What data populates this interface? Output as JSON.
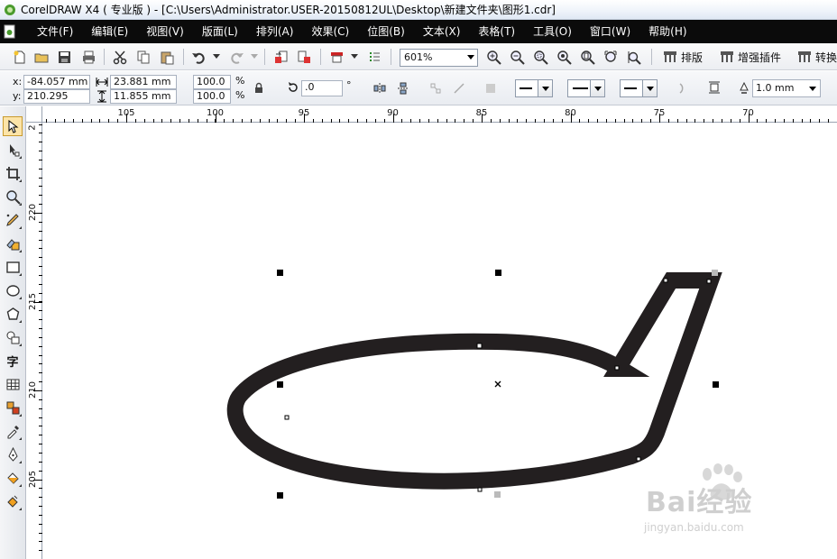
{
  "window": {
    "title": "CorelDRAW X4 ( 专业版 ) - [C:\\Users\\Administrator.USER-20150812UL\\Desktop\\新建文件夹\\图形1.cdr]"
  },
  "menu": {
    "items": [
      {
        "label": "文件(F)"
      },
      {
        "label": "编辑(E)"
      },
      {
        "label": "视图(V)"
      },
      {
        "label": "版面(L)"
      },
      {
        "label": "排列(A)"
      },
      {
        "label": "效果(C)"
      },
      {
        "label": "位图(B)"
      },
      {
        "label": "文本(X)"
      },
      {
        "label": "表格(T)"
      },
      {
        "label": "工具(O)"
      },
      {
        "label": "窗口(W)"
      },
      {
        "label": "帮助(H)"
      }
    ]
  },
  "toolbar": {
    "zoom_value": "601%",
    "plugins": [
      {
        "label": "排版"
      },
      {
        "label": "增强插件"
      },
      {
        "label": "转换"
      }
    ]
  },
  "property_bar": {
    "x_label": "x:",
    "y_label": "y:",
    "x_value": "-84.057 mm",
    "y_value": "210.295 mm",
    "width_value": "23.881 mm",
    "height_value": "11.855 mm",
    "scale_x": "100.0",
    "scale_y": "100.0",
    "percent": "%",
    "rotation_value": ".0",
    "degree_symbol": "°",
    "outline_width": "1.0 mm"
  },
  "rulers": {
    "horizontal_labels": [
      "105",
      "100",
      "95",
      "90",
      "85",
      "80",
      "75",
      "70"
    ],
    "vertical_labels": [
      "220",
      "215",
      "210",
      "205"
    ],
    "vertical_top_label": "2"
  },
  "watermark": {
    "logo_text": "Bai经验",
    "url": "jingyan.baidu.com"
  },
  "colors": {
    "menubar_bg": "#0b0b0b",
    "shape_fill": "#231f20",
    "selection_handle": "#000000"
  },
  "tools": [
    "pick-tool",
    "shape-tool",
    "crop-tool",
    "zoom-tool",
    "freehand-tool",
    "smart-fill-tool",
    "rectangle-tool",
    "ellipse-tool",
    "polygon-tool",
    "basic-shapes-tool",
    "text-tool",
    "table-tool",
    "blend-tool",
    "eyedropper-tool",
    "outline-tool",
    "fill-tool",
    "interactive-fill-tool"
  ]
}
